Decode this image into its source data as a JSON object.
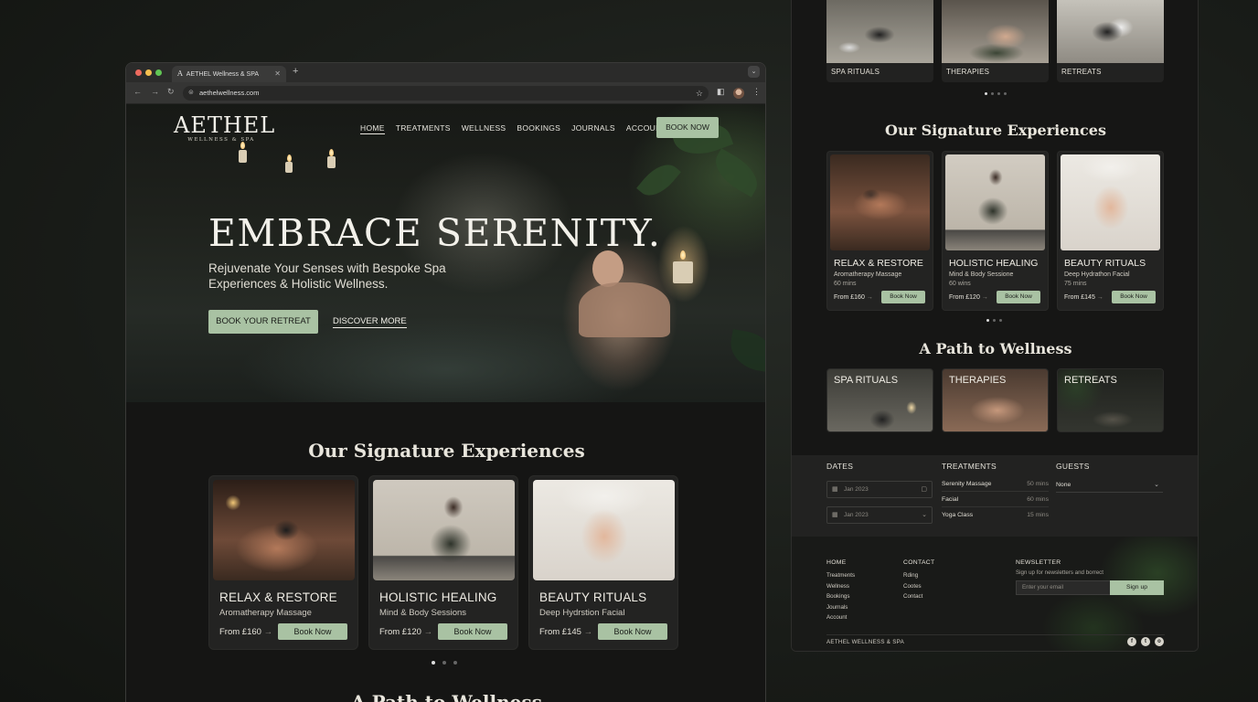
{
  "browser": {
    "tab_title": "AETHEL Wellness & SPA",
    "tab_favicon": "A",
    "new_tab": "+",
    "url": "aethelwellness.com"
  },
  "site": {
    "logo_main": "AETHEL",
    "logo_sub": "WELLNESS & SPA",
    "nav": [
      "HOME",
      "TREATMENTS",
      "WELLNESS",
      "BOOKINGS",
      "JOURNALS",
      "ACCOUNT"
    ],
    "nav_cta": "BOOK NOW"
  },
  "hero": {
    "title": "EMBRACE SERENITY.",
    "subtitle": "Rejuvenate Your Senses with Bespoke Spa Experiences & Holistic Wellness.",
    "primary_cta": "BOOK YOUR RETREAT",
    "secondary_cta": "DISCOVER MORE"
  },
  "signature": {
    "title": "Our Signature Experiences",
    "cards": [
      {
        "title": "RELAX & RESTORE",
        "subtitle": "Aromatherapy Massage",
        "price": "From £160",
        "arrow": "→",
        "button": "Book Now"
      },
      {
        "title": "HOLISTIC HEALING",
        "subtitle": "Mind & Body Sessions",
        "price": "From £120",
        "arrow": "→",
        "button": "Book Now"
      },
      {
        "title": "BEAUTY RITUALS",
        "subtitle": "Deep Hydrstion Facial",
        "price": "From £145",
        "arrow": "→",
        "button": "Book Now"
      }
    ]
  },
  "path": {
    "title": "A Path to Wellness"
  },
  "mobile": {
    "top_cards": [
      "SPA RITUALS",
      "THERAPIES",
      "RETREATS"
    ],
    "signature_title": "Our Signature Experiences",
    "cards": [
      {
        "title": "RELAX & RESTORE",
        "subtitle": "Aromatherapy Massage",
        "duration": "60 mins",
        "price": "From £160",
        "arrow": "→",
        "button": "Book Now"
      },
      {
        "title": "HOLISTIC HEALING",
        "subtitle": "Mind & Body Sessione",
        "duration": "60 wins",
        "price": "From £120",
        "arrow": "→",
        "button": "Book Now"
      },
      {
        "title": "BEAUTY RITUALS",
        "subtitle": "Deep Hydrathon Facial",
        "duration": "75 mins",
        "price": "From £145",
        "arrow": "→",
        "button": "Book Now"
      }
    ],
    "path_title": "A Path to Wellness",
    "path_tiles": [
      "SPA RITUALS",
      "THERAPIES",
      "RETREATS"
    ],
    "booking": {
      "dates_label": "DATES",
      "date_1": "Jan 2023",
      "date_2": "Jan 2023",
      "treatments_label": "TREATMENTS",
      "treatments": [
        {
          "name": "Serenity Massage",
          "duration": "50 mins"
        },
        {
          "name": "Facial",
          "duration": "60 mins"
        },
        {
          "name": "Yoga Class",
          "duration": "15 mins"
        }
      ],
      "guests_label": "GUESTS",
      "guests_value": "None"
    },
    "footer": {
      "home_heading": "HOME",
      "home_links": [
        "Treatments",
        "Wellness",
        "Bookings",
        "Journals",
        "Account"
      ],
      "contact_heading": "CONTACT",
      "contact_links": [
        "Rding",
        "Cootes",
        "Contact"
      ],
      "newsletter_heading": "NEWSLETTER",
      "newsletter_sub": "Sign up for newsletters and borrect",
      "newsletter_placeholder": "Enter your email",
      "newsletter_button": "Sign up",
      "copyright": "AETHEL WELLNESS & SPA",
      "social": [
        "f",
        "t",
        "o"
      ]
    }
  },
  "colors": {
    "accent": "#a9c2a3",
    "background": "#161615",
    "card": "#232322"
  }
}
